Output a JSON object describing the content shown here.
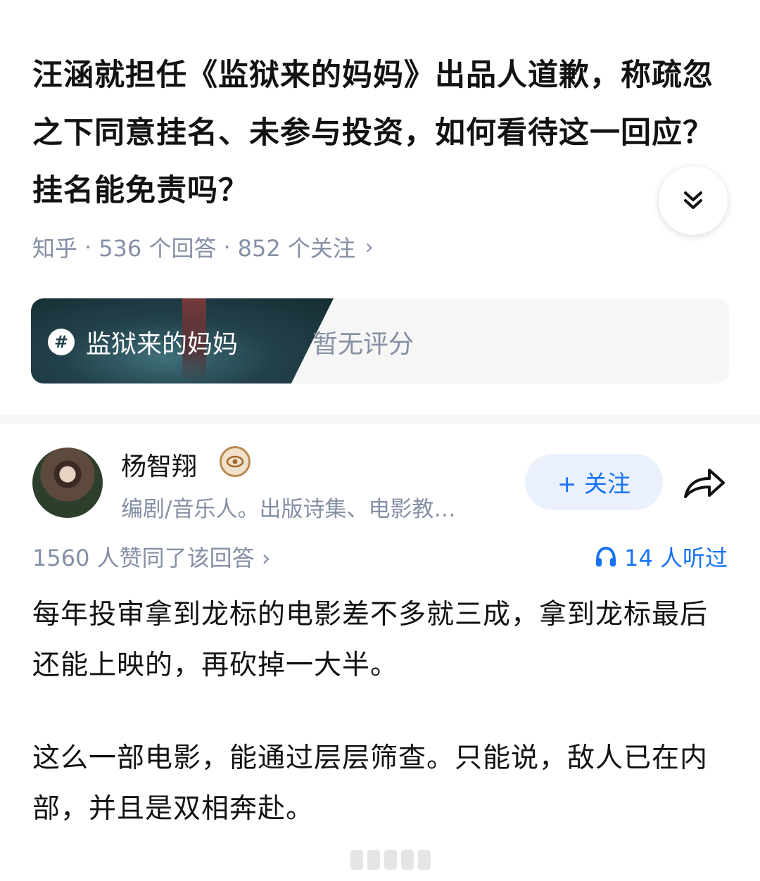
{
  "question": {
    "title": "汪涵就担任《监狱来的妈妈》出品人道歉，称疏忽之下同意挂名、未参与投资，如何看待这一回应？挂名能免责吗？",
    "source": "知乎",
    "answers": "536 个回答",
    "followers": "852 个关注"
  },
  "topic": {
    "name": "监狱来的妈妈",
    "rating": "暂无评分"
  },
  "author": {
    "name": "杨智翔",
    "bio": "编剧/音乐人。出版诗集、电影教…",
    "follow_label": "+ 关注"
  },
  "answer": {
    "likes": "1560 人赞同了该回答",
    "listens": "14 人听过",
    "paragraphs": [
      "每年投审拿到龙标的电影差不多就三成，拿到龙标最后还能上映的，再砍掉一大半。",
      "这么一部电影，能通过层层筛查。只能说，敌人已在内部，并且是双相奔赴。"
    ]
  },
  "icons": {
    "expand": "double-chevron-down-icon",
    "share": "share-arrow-icon",
    "headphones": "headphones-icon",
    "hash": "hash-icon",
    "badge": "creator-badge-icon"
  },
  "colors": {
    "accent": "#1772f6",
    "muted": "#8590a6",
    "text": "#121212",
    "follow_bg": "#eaf1fd"
  }
}
